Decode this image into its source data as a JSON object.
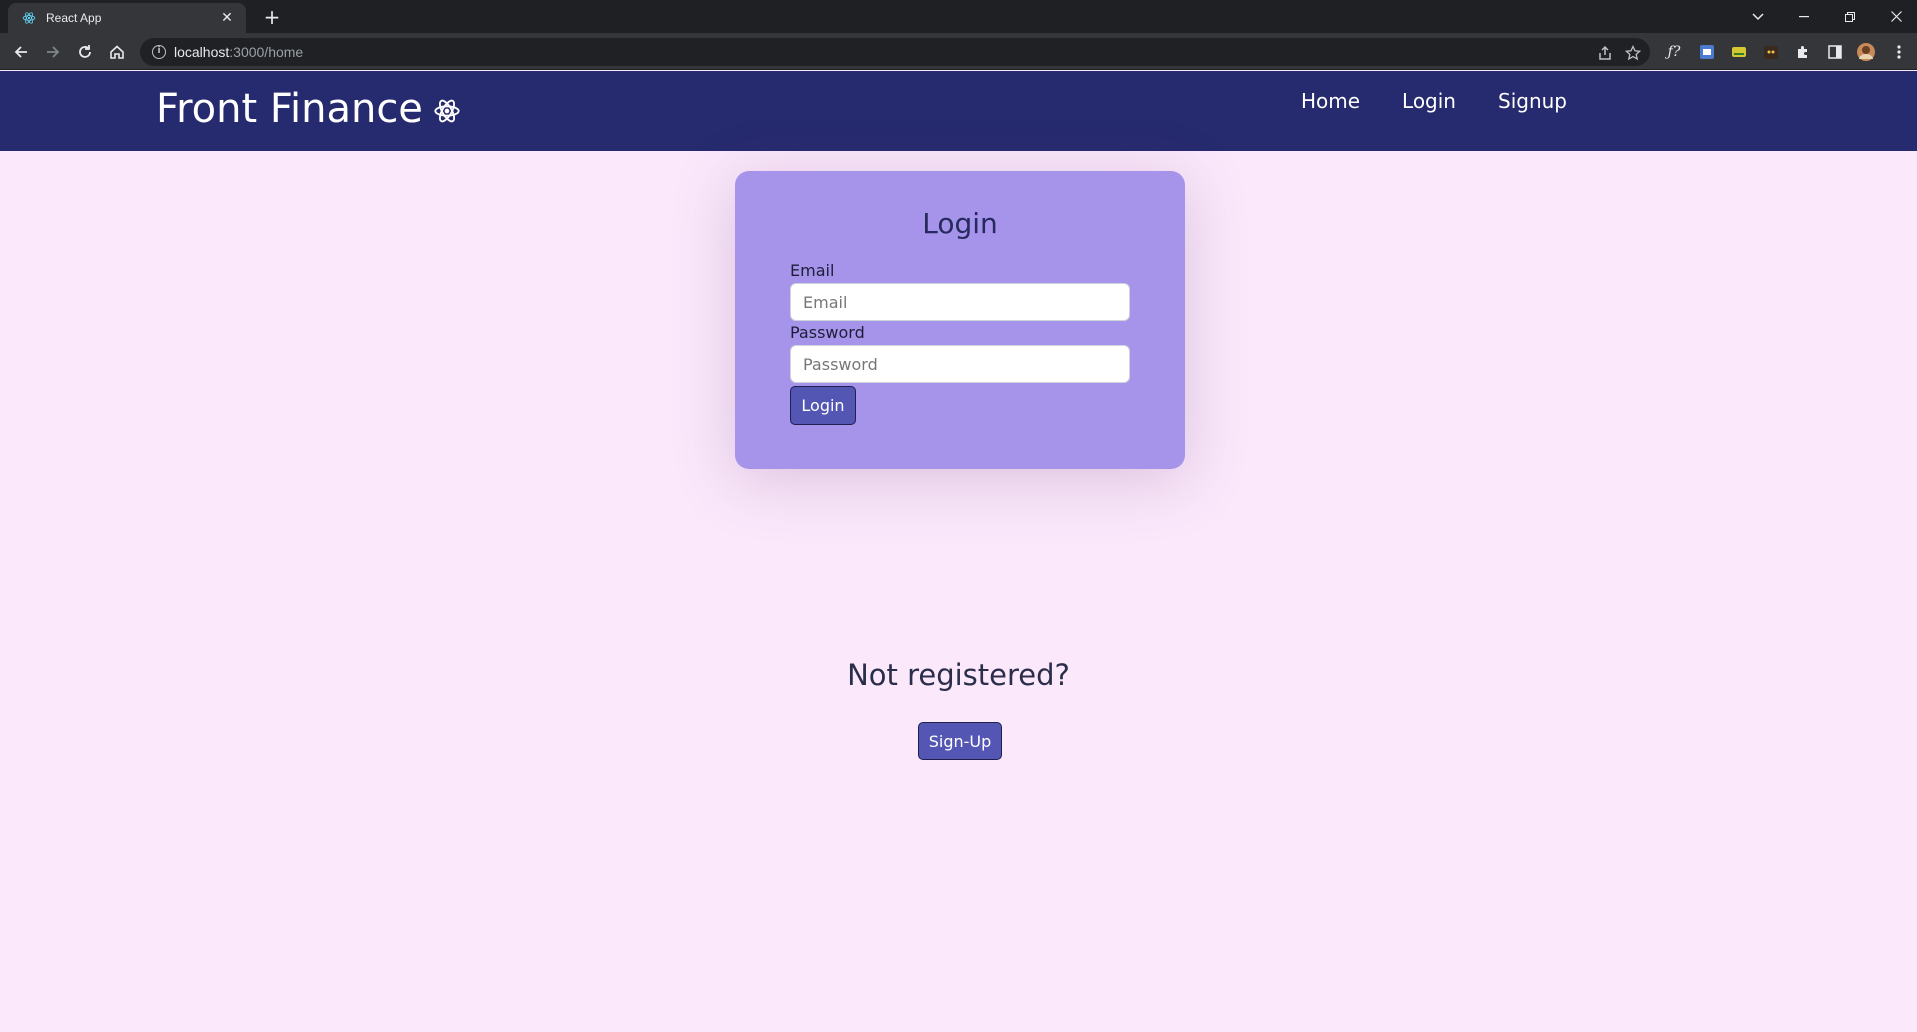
{
  "browser": {
    "tab_title": "React App",
    "tab_close": "✕",
    "new_tab": "+",
    "url_host": "localhost",
    "url_path": ":3000/home"
  },
  "navbar": {
    "brand": "Front Finance",
    "links": [
      "Home",
      "Login",
      "Signup"
    ]
  },
  "login_card": {
    "title": "Login",
    "email_label": "Email",
    "email_placeholder": "Email",
    "email_value": "",
    "password_label": "Password",
    "password_placeholder": "Password",
    "password_value": "",
    "submit_label": "Login"
  },
  "signup_prompt": {
    "text": "Not registered?",
    "button_label": "Sign-Up"
  },
  "colors": {
    "page_background": "#fbe8fb",
    "navbar_background": "#262a6e",
    "card_background": "#a594e9",
    "button_background": "#5356b3"
  }
}
